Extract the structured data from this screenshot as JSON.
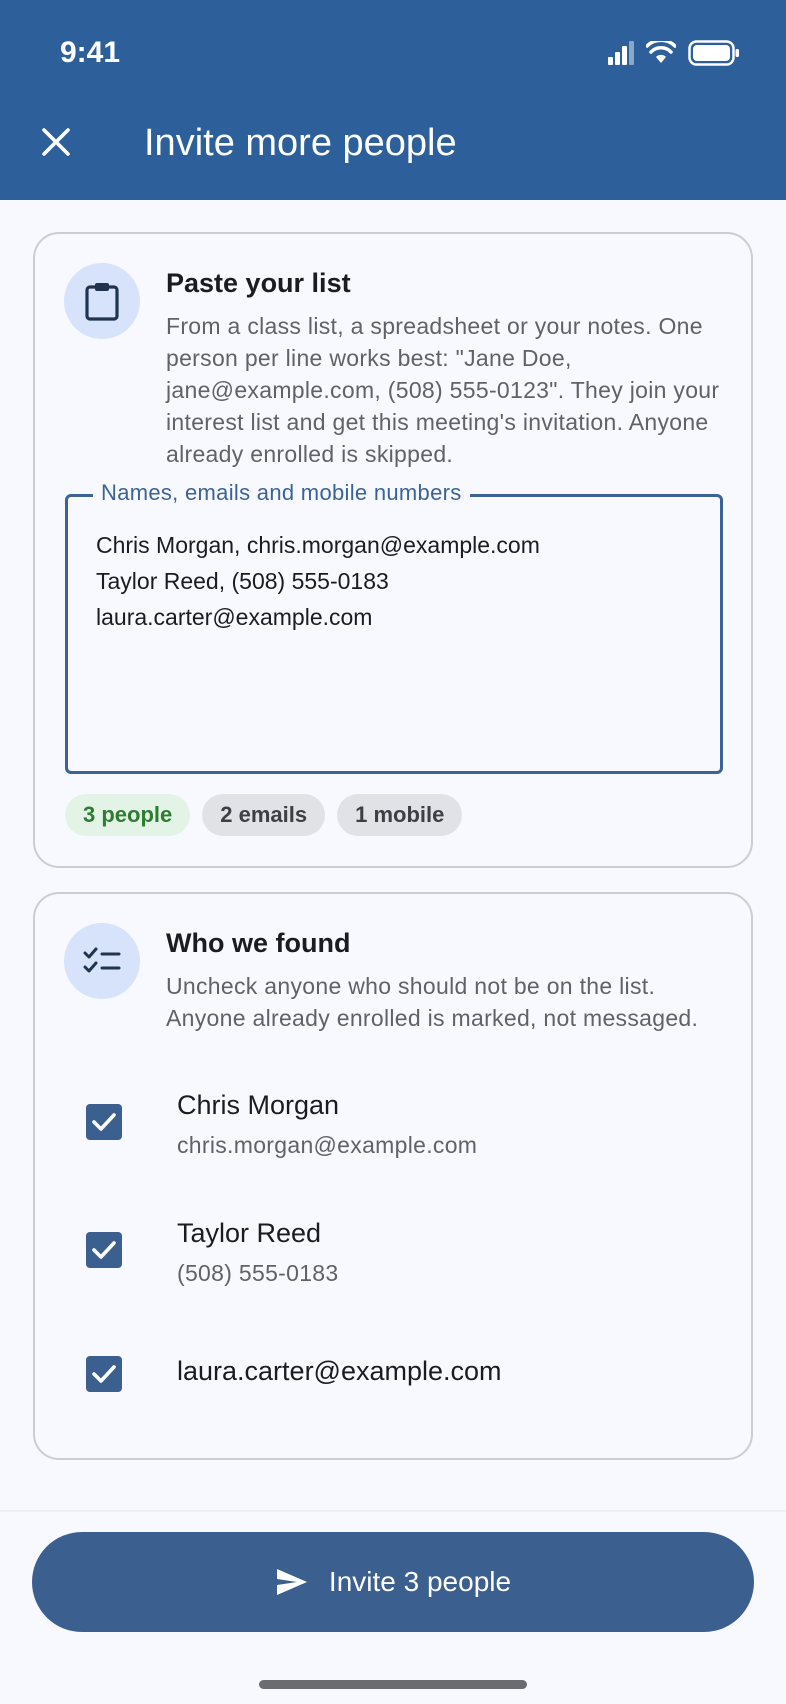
{
  "status_bar": {
    "time": "9:41"
  },
  "app_bar": {
    "title": "Invite more people",
    "close_icon": "close-icon"
  },
  "paste_card": {
    "title": "Paste your list",
    "description": "From a class list, a spreadsheet or your notes. One person per line works best: \"Jane Doe, jane@example.com, (508) 555-0123\". They join your interest list and get this meeting's invitation. Anyone already enrolled is skipped.",
    "field_label": "Names, emails and mobile numbers",
    "field_value": "Chris Morgan, chris.morgan@example.com\nTaylor Reed, (508) 555-0183\nlaura.carter@example.com",
    "chips": [
      {
        "label": "3 people",
        "style": "green"
      },
      {
        "label": "2 emails",
        "style": "grey"
      },
      {
        "label": "1 mobile",
        "style": "grey"
      }
    ]
  },
  "found_card": {
    "title": "Who we found",
    "description": "Uncheck anyone who should not be on the list. Anyone already enrolled is marked, not messaged.",
    "people": [
      {
        "name": "Chris Morgan",
        "detail": "chris.morgan@example.com",
        "checked": true
      },
      {
        "name": "Taylor Reed",
        "detail": "(508) 555-0183",
        "checked": true
      },
      {
        "name": "laura.carter@example.com",
        "detail": "",
        "checked": true
      }
    ]
  },
  "primary_action": {
    "label": "Invite 3 people",
    "icon": "send-icon"
  },
  "colors": {
    "app_bar": "#2d5f9b",
    "primary": "#3b5f8f",
    "chip_green": "#2e7d32"
  }
}
